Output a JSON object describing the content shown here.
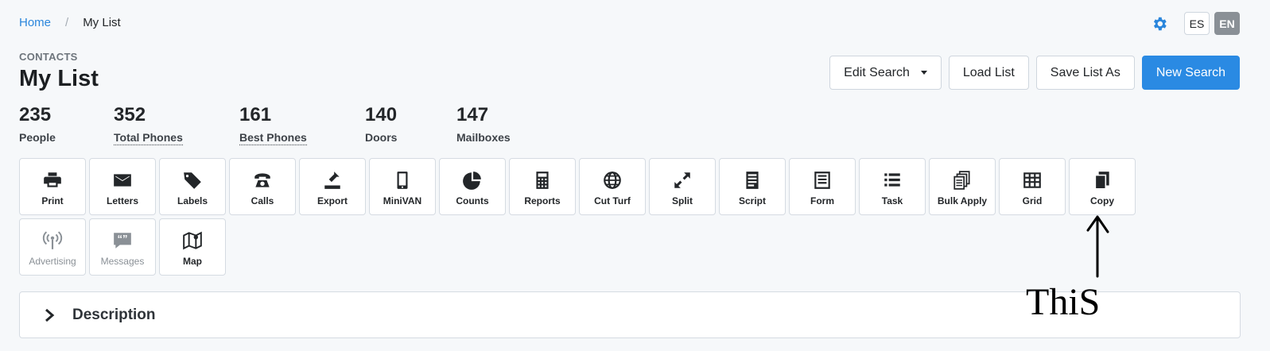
{
  "breadcrumb": {
    "home": "Home",
    "separator": "/",
    "current": "My List"
  },
  "header": {
    "eyebrow": "CONTACTS",
    "title": "My List"
  },
  "languages": [
    {
      "code": "ES",
      "active": false
    },
    {
      "code": "EN",
      "active": true
    }
  ],
  "actions": {
    "edit_search": "Edit Search",
    "load_list": "Load List",
    "save_list_as": "Save List As",
    "new_search": "New Search"
  },
  "stats": [
    {
      "value": "235",
      "label": "People"
    },
    {
      "value": "352",
      "label": "Total Phones"
    },
    {
      "value": "161",
      "label": "Best Phones"
    },
    {
      "value": "140",
      "label": "Doors"
    },
    {
      "value": "147",
      "label": "Mailboxes"
    }
  ],
  "tools": [
    {
      "label": "Print",
      "icon": "print-icon",
      "disabled": false
    },
    {
      "label": "Letters",
      "icon": "envelope-icon",
      "disabled": false
    },
    {
      "label": "Labels",
      "icon": "tags-icon",
      "disabled": false
    },
    {
      "label": "Calls",
      "icon": "phone-icon",
      "disabled": false
    },
    {
      "label": "Export",
      "icon": "export-icon",
      "disabled": false
    },
    {
      "label": "MiniVAN",
      "icon": "mobile-icon",
      "disabled": false
    },
    {
      "label": "Counts",
      "icon": "pie-chart-icon",
      "disabled": false
    },
    {
      "label": "Reports",
      "icon": "calculator-icon",
      "disabled": false
    },
    {
      "label": "Cut Turf",
      "icon": "globe-icon",
      "disabled": false
    },
    {
      "label": "Split",
      "icon": "expand-arrows-icon",
      "disabled": false
    },
    {
      "label": "Script",
      "icon": "script-icon",
      "disabled": false
    },
    {
      "label": "Form",
      "icon": "form-icon",
      "disabled": false
    },
    {
      "label": "Task",
      "icon": "list-icon",
      "disabled": false
    },
    {
      "label": "Bulk Apply",
      "icon": "stack-icon",
      "disabled": false
    },
    {
      "label": "Grid",
      "icon": "grid-icon",
      "disabled": false
    },
    {
      "label": "Copy",
      "icon": "copy-icon",
      "disabled": false
    },
    {
      "label": "Advertising",
      "icon": "broadcast-icon",
      "disabled": true
    },
    {
      "label": "Messages",
      "icon": "quote-bubble-icon",
      "disabled": true
    },
    {
      "label": "Map",
      "icon": "map-icon",
      "disabled": false
    }
  ],
  "description": {
    "label": "Description"
  },
  "annotation": {
    "handwritten_text": "ThiS"
  },
  "colors": {
    "accent": "#2a8ae3",
    "link": "#2a86dc",
    "background": "#f6f8fa",
    "disabled_text": "#8a9096"
  }
}
